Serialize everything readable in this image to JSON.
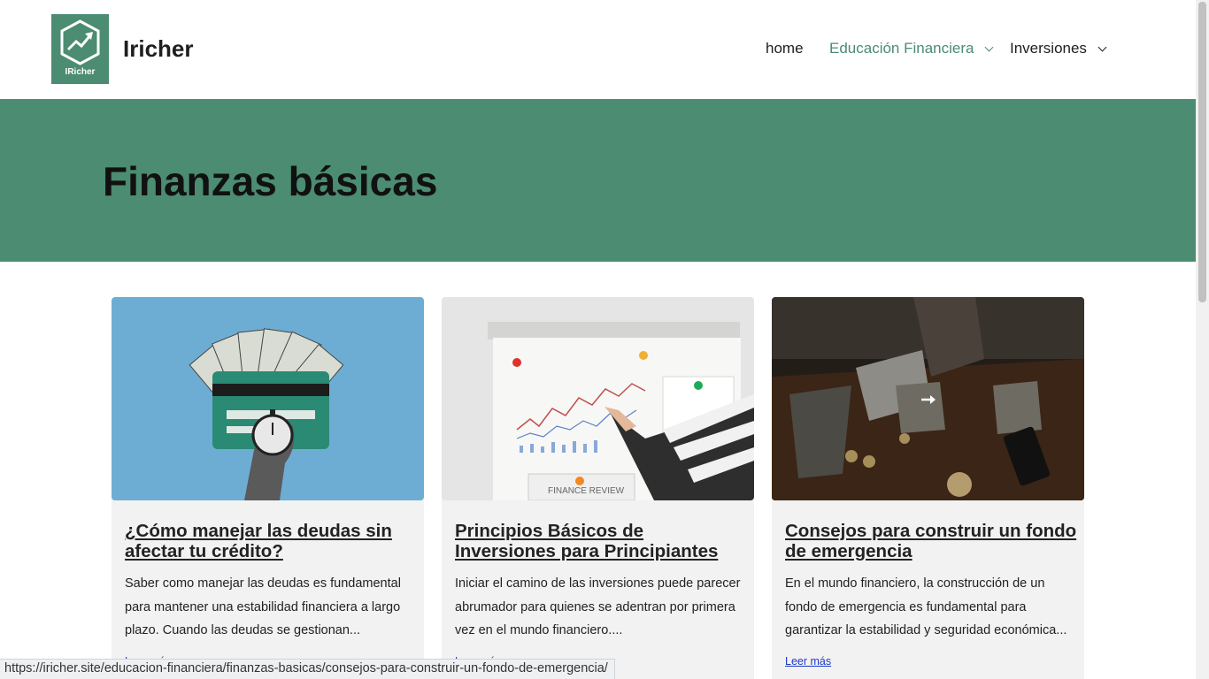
{
  "header": {
    "logo_text": "IRicher",
    "site_title": "Iricher",
    "nav": [
      {
        "label": "home"
      },
      {
        "label": "Educación Financiera"
      },
      {
        "label": "Inversiones"
      }
    ]
  },
  "hero": {
    "title": "Finanzas básicas"
  },
  "posts": [
    {
      "title": "¿Cómo manejar las deudas sin afectar tu crédito?",
      "excerpt": "Saber como manejar las deudas es fundamental para mantener una estabilidad financiera a largo plazo. Cuando las deudas se gestionan...",
      "more": "Leer más"
    },
    {
      "title": "Principios Básicos de Inversiones para Principiantes",
      "excerpt": "Iniciar el camino de las inversiones puede parecer abrumador para quienes se adentran por primera vez en el mundo financiero....",
      "more": "Leer más",
      "image_caption": "FINANCE REVIEW"
    },
    {
      "title": "Consejos para construir un fondo de emergencia",
      "excerpt": "En el mundo financiero, la construcción de un fondo de emergencia es fundamental para garantizar la estabilidad y seguridad económica...",
      "more": "Leer más"
    }
  ],
  "status_url": "https://iricher.site/educacion-financiera/finanzas-basicas/consejos-para-construir-un-fondo-de-emergencia/",
  "colors": {
    "brand_green": "#4b8c73",
    "card_bg": "#f2f2f2",
    "link_blue": "#1f3bc6",
    "thumb1_bg": "#6eadd3"
  },
  "icons": [
    "trend-up-icon",
    "chevron-down-icon",
    "arrow-right-icon"
  ]
}
